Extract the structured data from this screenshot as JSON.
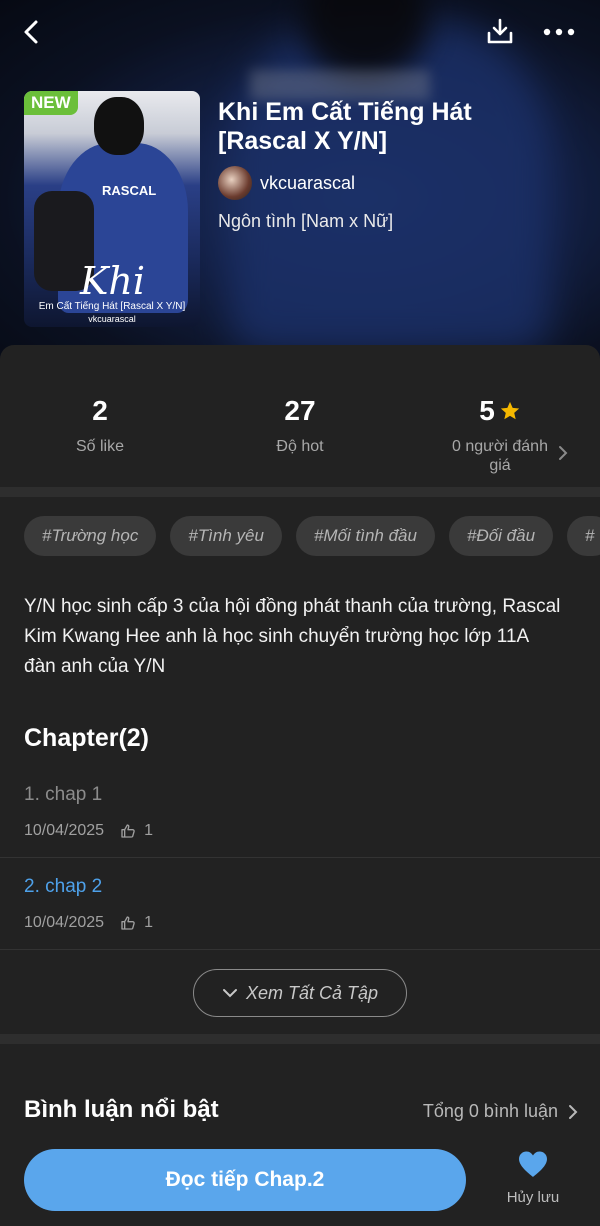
{
  "header": {
    "back_icon": "chevron-left-icon",
    "download_icon": "download-icon",
    "more_icon": "more-dots-icon"
  },
  "story": {
    "badge": "NEW",
    "title": "Khi Em Cất Tiếng Hát [Rascal X Y/N]",
    "author": "vkcuarascal",
    "genre": "Ngôn tình [Nam x Nữ]",
    "cover": {
      "jersey_text": "RASCAL",
      "script_text": "Khi",
      "subtitle": "Em Cất Tiếng Hát [Rascal X Y/N]",
      "author": "vkcuarascal"
    }
  },
  "stats": [
    {
      "value": "2",
      "label": "Số like"
    },
    {
      "value": "27",
      "label": "Độ hot"
    },
    {
      "value": "5",
      "label": "0 người đánh giá"
    }
  ],
  "tags": [
    "#Trường học",
    "#Tình yêu",
    "#Mối tình đầu",
    "#Đối đầu",
    "#"
  ],
  "description": "Y/N học sinh cấp 3 của hội đồng phát thanh của trường, Rascal Kim Kwang Hee anh là học sinh chuyển trường học lớp 11A đàn anh của Y/N",
  "chapters": {
    "heading": "Chapter(2)",
    "items": [
      {
        "name": "1. chap 1",
        "date": "10/04/2025",
        "likes": "1"
      },
      {
        "name": "2. chap 2",
        "date": "10/04/2025",
        "likes": "1"
      }
    ],
    "see_all": "Xem Tất Cả Tập"
  },
  "comments": {
    "heading": "Bình luận nổi bật",
    "total": "Tổng 0 bình luận"
  },
  "actions": {
    "read": "Đọc tiếp Chap.2",
    "unsave": "Hủy lưu"
  },
  "colors": {
    "accent": "#5aa6ec",
    "active_chapter": "#4ea1ea",
    "star": "#f5b800",
    "heart": "#5aa6ec",
    "new_badge": "#6bbf3a"
  }
}
